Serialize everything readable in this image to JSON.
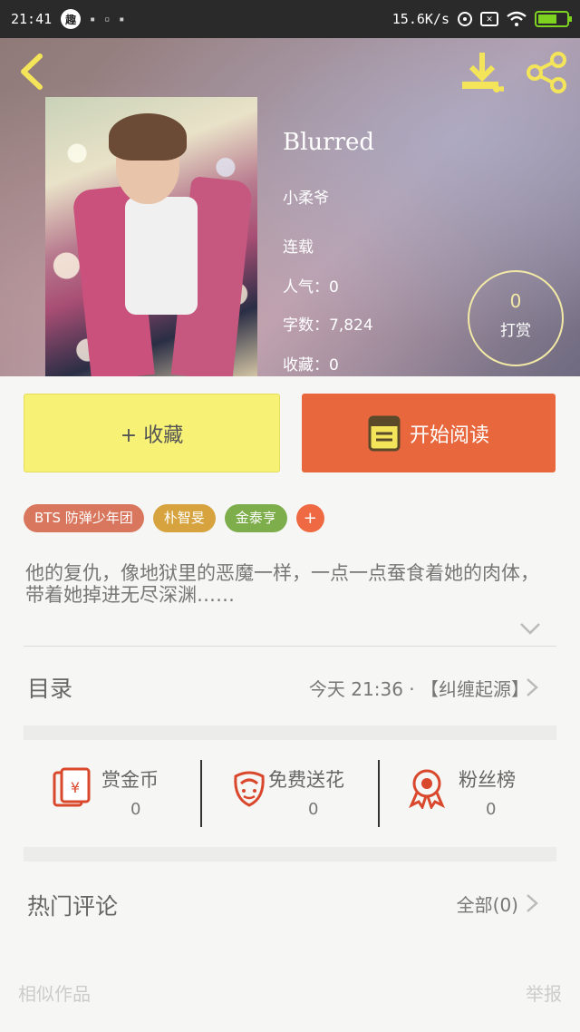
{
  "status_bar": {
    "time": "21:41",
    "app_badge": "趣",
    "net_speed": "15.6K/s"
  },
  "book": {
    "title": "Blurred",
    "author": "小柔爷",
    "status": "连载",
    "popularity": "人气：0",
    "word_count": "字数：7,824",
    "favorites": "收藏：0"
  },
  "tip": {
    "count": "0",
    "label": "打赏"
  },
  "actions": {
    "collect": "+ 收藏",
    "read": "开始阅读"
  },
  "tags": [
    "BTS 防弹少年团",
    "朴智旻",
    "金泰亨",
    "+"
  ],
  "description": "他的复仇，像地狱里的恶魔一样，一点一点蚕食着她的肉体，带着她掉进无尽深渊……",
  "toc": {
    "label": "目录",
    "latest": "今天 21:36 · 【纠缠起源】"
  },
  "stats": [
    {
      "label": "赏金币",
      "value": "0",
      "icon": "red-envelope-icon"
    },
    {
      "label": "免费送花",
      "value": "0",
      "icon": "flower-icon"
    },
    {
      "label": "粉丝榜",
      "value": "0",
      "icon": "medal-icon"
    }
  ],
  "comments": {
    "title": "热门评论",
    "all": "全部(0)"
  },
  "footer": {
    "similar": "相似作品",
    "report": "举报"
  },
  "colors": {
    "accent_yellow": "#f7f176",
    "accent_orange": "#e8673c",
    "icon_yellow": "#f3e45a",
    "icon_red": "#d9482c"
  }
}
